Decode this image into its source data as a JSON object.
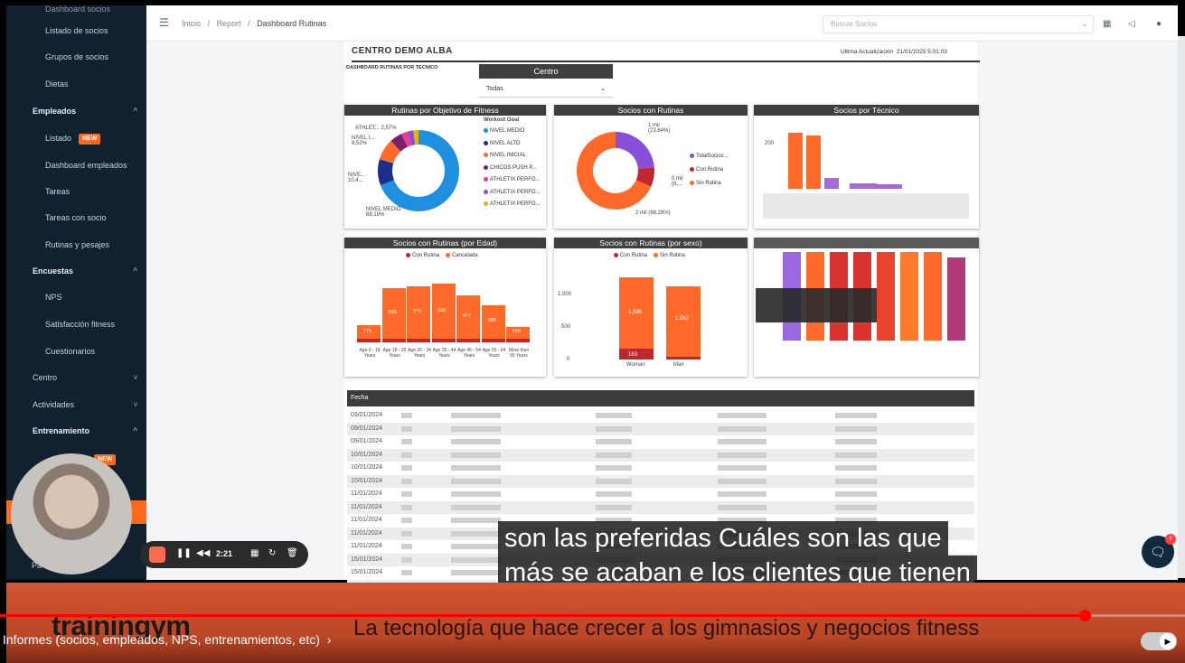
{
  "sidebar": {
    "top_partial": "Dashboard socios",
    "items": [
      {
        "label": "Listado de socios"
      },
      {
        "label": "Grupos de socios"
      },
      {
        "label": "Dietas"
      }
    ],
    "empleados": {
      "label": "Empleados",
      "children": [
        "Listado",
        "Dashboard empleados",
        "Tareas",
        "Tareas con socio",
        "Rutinas y pesajes"
      ],
      "new_badge": "NEW"
    },
    "encuestas": {
      "label": "Encuestas",
      "children": [
        "NPS",
        "Satisfacción fitness",
        "Cuestionarios"
      ]
    },
    "centro": "Centro",
    "actividades": "Actividades",
    "entrenamiento": {
      "label": "Entrenamiento",
      "new_badge": "NEW"
    },
    "bottom_partial": "Pa"
  },
  "header": {
    "breadcrumb": [
      "Inicio",
      "Report",
      "Dashboard Rutinas"
    ],
    "separator": "/",
    "search_placeholder": "Buscar Socios"
  },
  "report": {
    "title": "CENTRO DEMO ALBA",
    "last_update_label": "Ultima Actualización",
    "last_update_value": "21/01/2025 5:01:03",
    "subtitle": "DASHBOARD RUTINAS POR TECNICO",
    "centro_label": "Centro",
    "centro_value": "Todas"
  },
  "chart_data": [
    {
      "type": "pie",
      "title": "Rutinas por Objetivo de Fitness",
      "legend_title": "Workout Goal",
      "legend": [
        "NIVEL MEDIO",
        "NIVEL ALTO",
        "NIVEL INICIAL",
        "CHICOS PUSH P...",
        "ATHLETIX PERFO...",
        "ATHLETIX PERFO...",
        "ATHLETIX PERFO..."
      ],
      "colors": [
        "#1f8fe0",
        "#1b2f8a",
        "#ff6a2a",
        "#7a1f6e",
        "#e83e8c",
        "#8a4fd8",
        "#e8b400"
      ],
      "values": [
        69.19,
        10.4,
        8.52,
        5.0,
        2.57,
        2.3,
        2.02
      ],
      "slice_labels": [
        "NIVEL MEDIO 69,19%",
        "NIVE... 10,4...",
        "NIVEL I... 8,52%",
        "ATHLET... 2,57%"
      ]
    },
    {
      "type": "pie",
      "title": "Socios con Rutinas",
      "legend": [
        "TotalSocios...",
        "Con Rutina",
        "Sin Rutina"
      ],
      "colors": [
        "#8a4fd8",
        "#c0262e",
        "#ff6a2a"
      ],
      "values": [
        23.64,
        0.08,
        68.28
      ],
      "slice_labels": [
        "1 mil (23,64%)",
        "0 mil (8,...",
        "2 mil (68,28%)"
      ]
    },
    {
      "type": "bar",
      "title": "Socios por Técnico",
      "y_tick": "200",
      "values": [
        210,
        200,
        40,
        20,
        18
      ],
      "colors": [
        "#ff6a2a",
        "#ff6a2a",
        "#a66ad8",
        "#a66ad8",
        "#a66ad8"
      ]
    },
    {
      "type": "bar",
      "title": "Socios con Rutinas (por Edad)",
      "legend": [
        "Con Rutina",
        "Cancelada"
      ],
      "categories": [
        "Age 0 - 18 Years",
        "Age 18 - 25 Years",
        "Age 26 - 34 Years",
        "Age 35 - 44 Years",
        "Age 45 - 54 Years",
        "Age 55 - 64 Years",
        "More than 65 Years"
      ],
      "values": [
        175,
        558,
        570,
        600,
        477,
        380,
        158
      ],
      "value_labels": [
        "175",
        "558",
        "570",
        "600",
        "477",
        "380",
        "158"
      ]
    },
    {
      "type": "bar",
      "title": "Socios con Rutinas (por sexo)",
      "legend": [
        "Con Rutina",
        "Sin Rutina"
      ],
      "categories": [
        "Woman",
        "Man"
      ],
      "y_ticks": [
        "1.000",
        "500",
        "0"
      ],
      "series": [
        {
          "name": "Con Rutina",
          "values": [
            163,
            45
          ]
        },
        {
          "name": "Sin Rutina",
          "values": [
            1096,
            1082
          ]
        }
      ],
      "value_labels": [
        "1.096",
        "163",
        "1.082"
      ]
    }
  ],
  "table": {
    "headers": [
      "Fecha"
    ],
    "dates": [
      "03/01/2024",
      "09/01/2024",
      "09/01/2024",
      "10/01/2024",
      "10/01/2024",
      "10/01/2024",
      "11/01/2024",
      "11/01/2024",
      "11/01/2024",
      "11/01/2024",
      "11/01/2024",
      "15/01/2024",
      "15/01/2024",
      "15/01/2024"
    ]
  },
  "video": {
    "timer": "2:21",
    "caption_line1": "son las preferidas Cuáles son las que",
    "caption_line2": "más se acaban e los clientes que tienen",
    "banner_logo": "trainingym",
    "banner_tagline": "La tecnología que hace crecer a los gimnasios y negocios fitness",
    "chapter": "Informes (socios, empleados, NPS, entrenamientos, etc)",
    "progress_fraction": 0.915,
    "chat_badge": "!!"
  }
}
